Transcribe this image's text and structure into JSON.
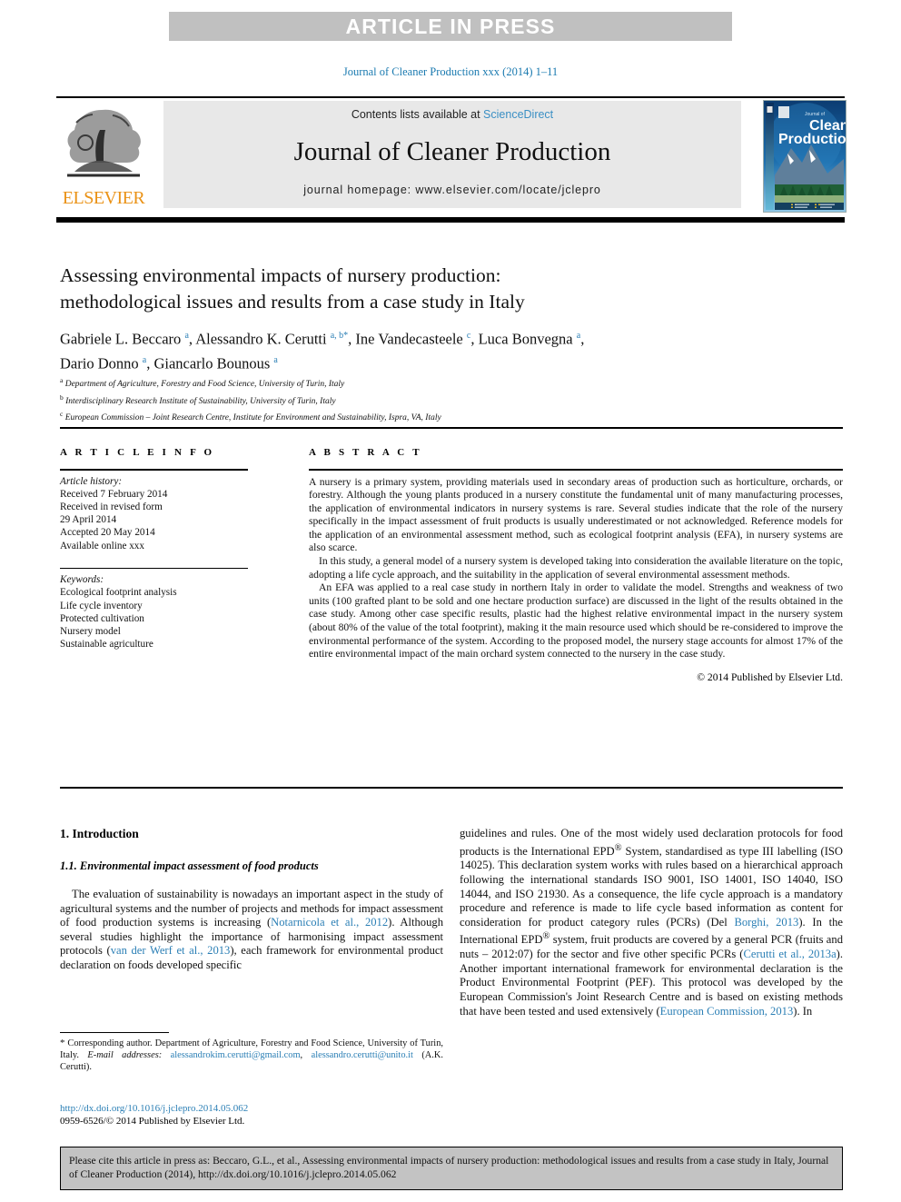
{
  "banner": {
    "label": "ARTICLE IN PRESS"
  },
  "running_head": "Journal of Cleaner Production xxx (2014) 1–11",
  "journal_header": {
    "contents_prefix": "Contents lists available at ",
    "sciencedirect_link": "ScienceDirect",
    "journal_title": "Journal of Cleaner Production",
    "homepage": "journal homepage: www.elsevier.com/locate/jclepro",
    "publisher_logo_text": "ELSEVIER",
    "cover_title_small": "Journal of",
    "cover_title_line1": "Cleaner",
    "cover_title_line2": "Production"
  },
  "article": {
    "title_line1": "Assessing environmental impacts of nursery production:",
    "title_line2": "methodological issues and results from a case study in Italy",
    "authors_line1_a": "Gabriele L. Beccaro ",
    "authors_line1_m1": "a",
    "authors_line1_b": ", Alessandro K. Cerutti ",
    "authors_line1_m2": "a, b",
    "authors_line1_star": "*",
    "authors_line1_c": ", Ine Vandecasteele ",
    "authors_line1_m3": "c",
    "authors_line1_d": ", Luca Bonvegna ",
    "authors_line1_m4": "a",
    "authors_line1_e": ",",
    "authors_line2_a": "Dario Donno ",
    "authors_line2_m1": "a",
    "authors_line2_b": ", Giancarlo Bounous ",
    "authors_line2_m2": "a",
    "affiliations": [
      {
        "mark": "a",
        "text": "Department of Agriculture, Forestry and Food Science, University of Turin, Italy"
      },
      {
        "mark": "b",
        "text": "Interdisciplinary Research Institute of Sustainability, University of Turin, Italy"
      },
      {
        "mark": "c",
        "text": "European Commission – Joint Research Centre, Institute for Environment and Sustainability, Ispra, VA, Italy"
      }
    ]
  },
  "article_info": {
    "heading": "A R T I C L E  I N F O",
    "history_label": "Article history:",
    "history": [
      "Received 7 February 2014",
      "Received in revised form",
      "29 April 2014",
      "Accepted 20 May 2014",
      "Available online xxx"
    ],
    "keywords_label": "Keywords:",
    "keywords": [
      "Ecological footprint analysis",
      "Life cycle inventory",
      "Protected cultivation",
      "Nursery model",
      "Sustainable agriculture"
    ]
  },
  "abstract": {
    "heading": "A B S T R A C T",
    "paragraphs": [
      "A nursery is a primary system, providing materials used in secondary areas of production such as horticulture, orchards, or forestry. Although the young plants produced in a nursery constitute the fundamental unit of many manufacturing processes, the application of environmental indicators in nursery systems is rare. Several studies indicate that the role of the nursery specifically in the impact assessment of fruit products is usually underestimated or not acknowledged. Reference models for the application of an environmental assessment method, such as ecological footprint analysis (EFA), in nursery systems are also scarce.",
      "In this study, a general model of a nursery system is developed taking into consideration the available literature on the topic, adopting a life cycle approach, and the suitability in the application of several environmental assessment methods.",
      "An EFA was applied to a real case study in northern Italy in order to validate the model. Strengths and weakness of two units (100 grafted plant to be sold and one hectare production surface) are discussed in the light of the results obtained in the case study. Among other case specific results, plastic had the highest relative environmental impact in the nursery system (about 80% of the value of the total footprint), making it the main resource used which should be re-considered to improve the environmental performance of the system. According to the proposed model, the nursery stage accounts for almost 17% of the entire environmental impact of the main orchard system connected to the nursery in the case study."
    ],
    "copyright": "© 2014 Published by Elsevier Ltd."
  },
  "body": {
    "section_heading": "1. Introduction",
    "subsection_heading": "1.1. Environmental impact assessment of food products",
    "left_paragraph_parts": {
      "p1": "The evaluation of sustainability is nowadays an important aspect in the study of agricultural systems and the number of projects and methods for impact assessment of food production systems is increasing (",
      "ref1": "Notarnicola et al., 2012",
      "p2": "). Although several studies highlight the importance of harmonising impact assessment protocols (",
      "ref2": "van der Werf et al., 2013",
      "p3": "), each framework for environmental product declaration on foods developed specific"
    },
    "right_paragraph_parts": {
      "p1": "guidelines and rules. One of the most widely used declaration protocols for food products is the International EPD",
      "sup1": "®",
      "p2": " System, standardised as type III labelling (ISO 14025). This declaration system works with rules based on a hierarchical approach following the international standards ISO 9001, ISO 14001, ISO 14040, ISO 14044, and ISO 21930. As a consequence, the life cycle approach is a mandatory procedure and reference is made to life cycle based information as content for consideration for product category rules (PCRs) (Del ",
      "ref1": "Borghi, 2013",
      "p3": "). In the International EPD",
      "sup2": "®",
      "p4": " system, fruit products are covered by a general PCR (fruits and nuts – 2012:07) for the sector and five other specific PCRs (",
      "ref2": "Cerutti et al., 2013a",
      "p5": "). Another important international framework for environmental declaration is the Product Environmental Footprint (PEF). This protocol was developed by the European Commission's Joint Research Centre and is based on existing methods that have been tested and used extensively (",
      "ref3": "European Commission, 2013",
      "p6": "). In"
    }
  },
  "footnote": {
    "star": "*",
    "corresponding": " Corresponding author. Department of Agriculture, Forestry and Food Science, University of Turin, Italy.",
    "email_label": "E-mail addresses:",
    "email1": "alessandrokim.cerutti@gmail.com",
    "email_sep": ", ",
    "email2": "alessandro.cerutti@unito.it",
    "email_suffix": " (A.K. Cerutti)."
  },
  "doi_block": {
    "doi": "http://dx.doi.org/10.1016/j.jclepro.2014.05.062",
    "issn_line": "0959-6526/© 2014 Published by Elsevier Ltd."
  },
  "cite_box": {
    "text": "Please cite this article in press as: Beccaro, G.L., et al., Assessing environmental impacts of nursery production: methodological issues and results from a case study in Italy, Journal of Cleaner Production (2014), http://dx.doi.org/10.1016/j.jclepro.2014.05.062"
  },
  "colors": {
    "link_blue": "#2b7fb5",
    "elsevier_orange": "#ea9216",
    "banner_grey": "#c0c0c0",
    "panel_grey": "#e8e8e8",
    "cite_grey": "#c3c3c3"
  }
}
